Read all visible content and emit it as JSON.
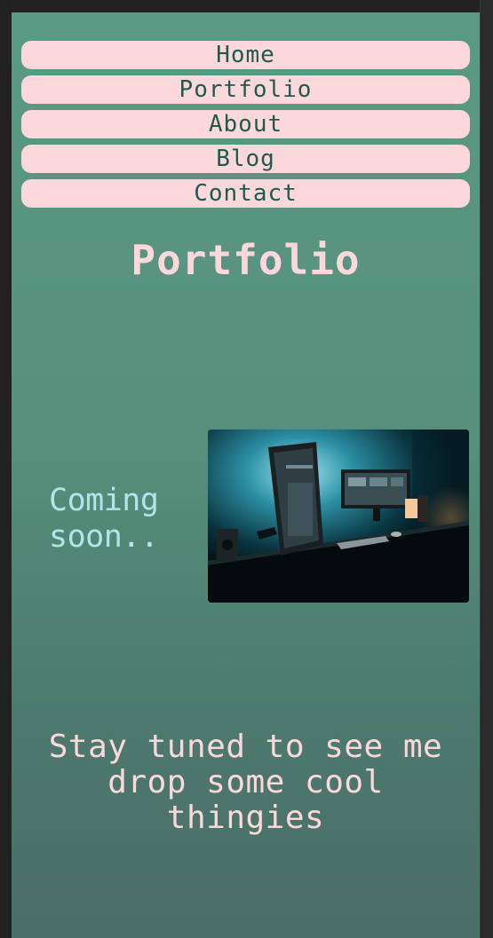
{
  "nav": {
    "items": [
      {
        "label": "Home"
      },
      {
        "label": "Portfolio"
      },
      {
        "label": "About"
      },
      {
        "label": "Blog"
      },
      {
        "label": "Contact"
      }
    ]
  },
  "main": {
    "title": "Portfolio",
    "coming_soon": "Coming soon..",
    "tagline": "Stay tuned to see me drop some cool thingies",
    "image": {
      "subject": "desk-setup-photo"
    }
  },
  "colors": {
    "page_top": "#5a9a84",
    "page_bottom": "#4a6e68",
    "nav_bg": "#fcd8dc",
    "nav_text": "#1f5a4c",
    "title_text": "#fcd8dc",
    "coming_soon_text": "#aee6ec"
  }
}
